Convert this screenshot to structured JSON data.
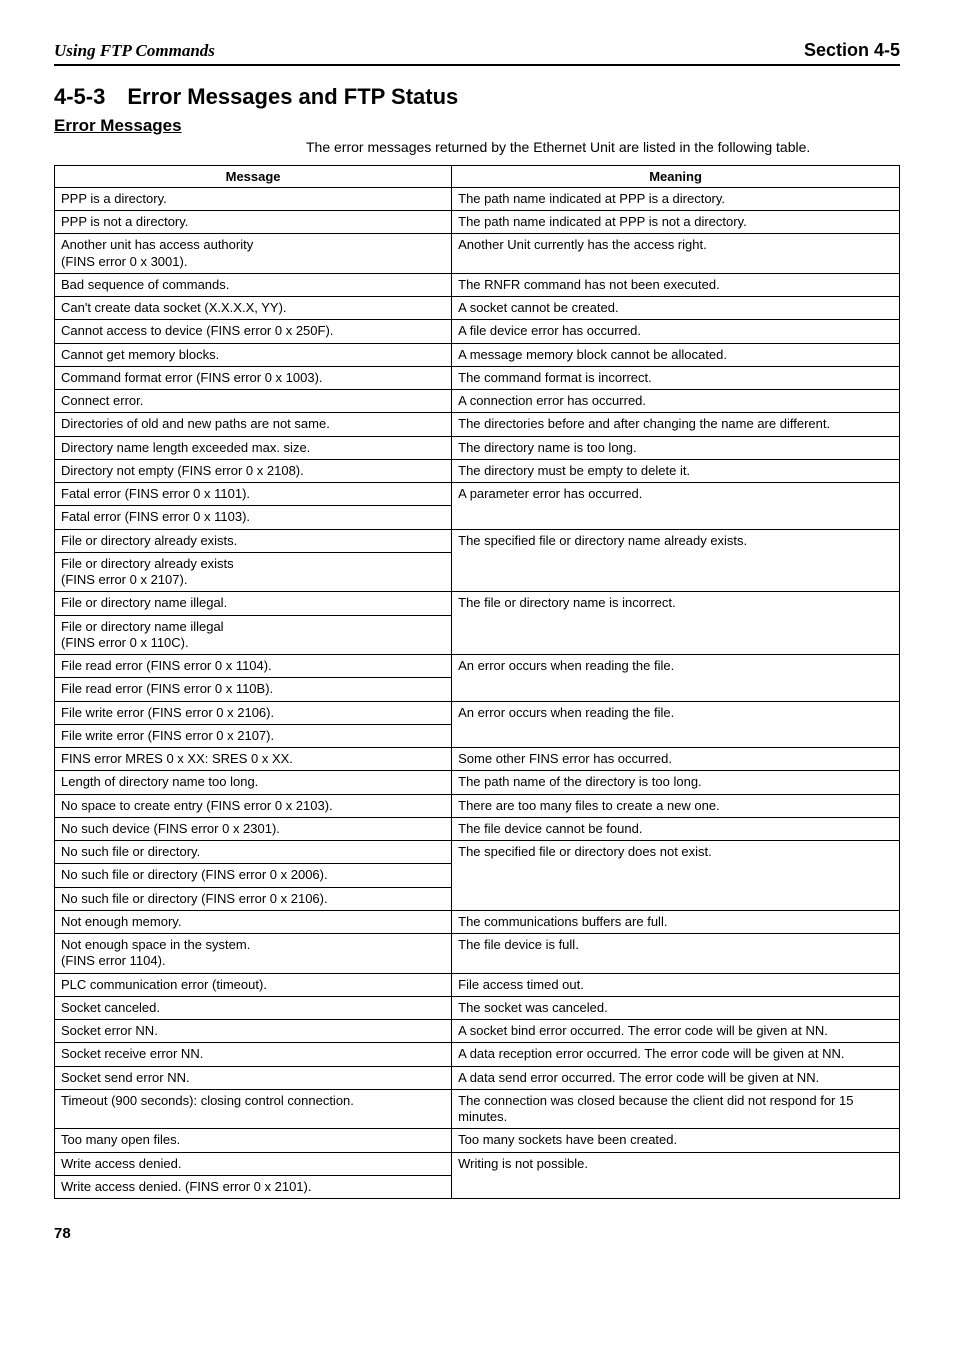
{
  "header": {
    "left": "Using FTP Commands",
    "right": "Section 4-5"
  },
  "section": {
    "number": "4-5-3",
    "title": "Error Messages and FTP Status"
  },
  "subheading": "Error Messages",
  "intro": "The error messages returned by the Ethernet Unit are listed in the following table.",
  "table": {
    "head": {
      "message": "Message",
      "meaning": "Meaning"
    },
    "groups": [
      {
        "meaning": "The path name indicated at PPP is a directory.",
        "messages": [
          "PPP is a directory."
        ]
      },
      {
        "meaning": "The path name indicated at PPP is not a directory.",
        "messages": [
          "PPP is not a directory."
        ]
      },
      {
        "meaning": "Another Unit currently has the access right.",
        "messages": [
          "Another unit has access authority\n(FINS error 0 x 3001)."
        ]
      },
      {
        "meaning": "The RNFR command has not been executed.",
        "messages": [
          "Bad sequence of commands."
        ]
      },
      {
        "meaning": "A socket cannot be created.",
        "messages": [
          "Can't create data socket (X.X.X.X, YY)."
        ]
      },
      {
        "meaning": "A file device error has occurred.",
        "messages": [
          "Cannot access to device (FINS error 0 x 250F)."
        ]
      },
      {
        "meaning": "A message memory block cannot be allocated.",
        "messages": [
          "Cannot get memory blocks."
        ]
      },
      {
        "meaning": "The command format is incorrect.",
        "messages": [
          "Command format error (FINS error 0 x 1003)."
        ]
      },
      {
        "meaning": "A connection error has occurred.",
        "messages": [
          "Connect error."
        ]
      },
      {
        "meaning": "The directories before and after changing the name are different.",
        "messages": [
          "Directories of old and new paths are not same."
        ]
      },
      {
        "meaning": "The directory name is too long.",
        "messages": [
          "Directory name length exceeded max. size."
        ]
      },
      {
        "meaning": "The directory must be empty to delete it.",
        "messages": [
          "Directory not empty (FINS error 0 x 2108)."
        ]
      },
      {
        "meaning": "A parameter error has occurred.",
        "messages": [
          "Fatal error (FINS error 0 x 1101).",
          "Fatal error (FINS error 0 x 1103)."
        ]
      },
      {
        "meaning": "The specified file or directory name already exists.",
        "messages": [
          "File or directory already exists.",
          "File or directory already exists\n(FINS error 0 x 2107)."
        ]
      },
      {
        "meaning": "The file or directory name is incorrect.",
        "messages": [
          "File or directory name illegal.",
          "File or directory name illegal\n(FINS error 0 x 110C)."
        ]
      },
      {
        "meaning": "An error occurs when reading the file.",
        "messages": [
          "File read error (FINS error 0 x 1104).",
          "File read error (FINS error 0 x 110B)."
        ]
      },
      {
        "meaning": "An error occurs when reading the file.",
        "messages": [
          "File write error (FINS error 0 x 2106).",
          "File write error (FINS error 0 x 2107)."
        ]
      },
      {
        "meaning": "Some other FINS error has occurred.",
        "messages": [
          "FINS error MRES 0 x XX: SRES 0 x XX."
        ]
      },
      {
        "meaning": "The path name of the directory is too long.",
        "messages": [
          "Length of directory name too long."
        ]
      },
      {
        "meaning": "There are too many files to create a new one.",
        "messages": [
          "No space to create entry (FINS error 0 x 2103)."
        ]
      },
      {
        "meaning": "The file device cannot be found.",
        "messages": [
          "No such device (FINS error 0 x 2301)."
        ]
      },
      {
        "meaning": "The specified file or directory does not exist.",
        "messages": [
          "No such file or directory.",
          "No such file or directory (FINS error 0 x 2006).",
          "No such file or directory (FINS error 0 x 2106)."
        ]
      },
      {
        "meaning": "The communications buffers are full.",
        "messages": [
          "Not enough memory."
        ]
      },
      {
        "meaning": "The file device is full.",
        "messages": [
          "Not enough space in the system.\n(FINS error 1104)."
        ]
      },
      {
        "meaning": "File access timed out.",
        "messages": [
          "PLC communication error (timeout)."
        ]
      },
      {
        "meaning": "The socket was canceled.",
        "messages": [
          "Socket canceled."
        ]
      },
      {
        "meaning": "A socket bind error occurred. The error code will be given at NN.",
        "messages": [
          "Socket error NN."
        ]
      },
      {
        "meaning": "A data reception error occurred. The error code will be given at NN.",
        "messages": [
          "Socket receive error NN."
        ]
      },
      {
        "meaning": "A data send error occurred. The error code will be given at NN.",
        "messages": [
          "Socket send error NN."
        ]
      },
      {
        "meaning": "The connection was closed because the client did not respond for 15 minutes.",
        "messages": [
          "Timeout (900 seconds): closing control connection."
        ]
      },
      {
        "meaning": "Too many sockets have been created.",
        "messages": [
          "Too many open files."
        ]
      },
      {
        "meaning": "Writing is not possible.",
        "messages": [
          "Write access denied.",
          "Write access denied. (FINS error 0 x 2101)."
        ]
      }
    ]
  },
  "page_number": "78"
}
